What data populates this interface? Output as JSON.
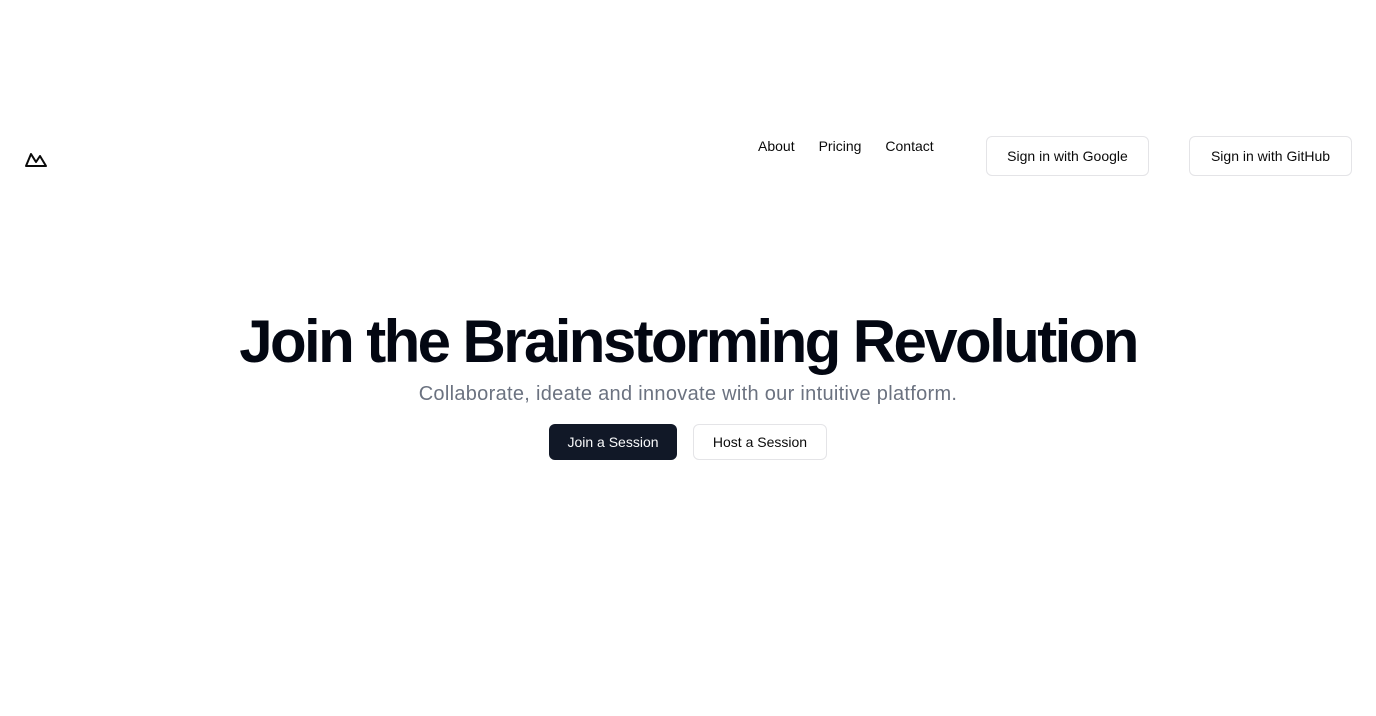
{
  "header": {
    "logo_icon": "mountain-icon",
    "nav": {
      "about": "About",
      "pricing": "Pricing",
      "contact": "Contact"
    },
    "auth": {
      "google_label": "Sign in with Google",
      "github_label": "Sign in with GitHub"
    }
  },
  "hero": {
    "title": "Join the Brainstorming Revolution",
    "subtitle": "Collaborate, ideate and innovate with our intuitive platform.",
    "primary_cta": "Join a Session",
    "secondary_cta": "Host a Session"
  },
  "colors": {
    "primary_button_bg": "#111827",
    "subtitle_text": "#6b7280",
    "border": "#e4e4e7"
  }
}
